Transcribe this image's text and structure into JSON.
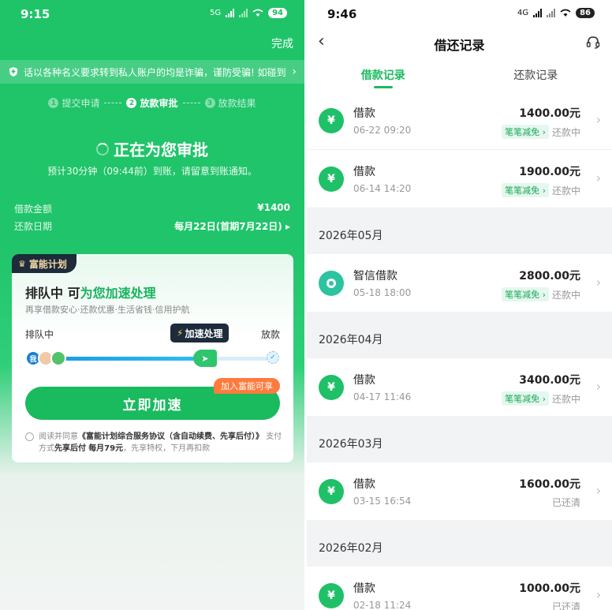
{
  "left": {
    "status": {
      "time": "9:15",
      "network": "5G",
      "battery": "94"
    },
    "done_label": "完成",
    "notice": "话以各种名义要求转到私人账户的均是诈骗，谨防受骗! 如碰到",
    "steps": [
      {
        "num": "1",
        "label": "提交申请"
      },
      {
        "num": "2",
        "label": "放款审批"
      },
      {
        "num": "3",
        "label": "放款结果"
      }
    ],
    "review": {
      "title": "正在为您审批",
      "subtitle": "预计30分钟（09:44前）到账，请留意到账通知。"
    },
    "loan_amount": {
      "label": "借款金额",
      "value": "¥1400"
    },
    "repay_date": {
      "label": "还款日期",
      "value": "每月22日(首期7月22日) ▸"
    },
    "card": {
      "badge": "富能计划",
      "headline_prefix": "排队中 可",
      "headline_accent": "为您加速处理",
      "subline": "再享借款安心·还款优惠·生活省钱·信用护航",
      "queue_label": "排队中",
      "release_label": "放款",
      "speed_tip": "加速处理",
      "avatar_me": "我",
      "queue_progress": 0.68,
      "cta": "立即加速",
      "cta_tag": "加入富能可享",
      "agree_prefix": "阅读并同意",
      "agree_link": "《富能计划综合服务协议（含自动续费、先享后付）》",
      "agree_mid": "支付方式",
      "agree_bold1": "先享后付",
      "agree_fee": "每月79元",
      "agree_tail": "，先享特权，下月再扣款"
    }
  },
  "right": {
    "status": {
      "time": "9:46",
      "network": "4G",
      "battery": "86"
    },
    "title": "借还记录",
    "tabs": [
      {
        "label": "借款记录",
        "active": true
      },
      {
        "label": "还款记录",
        "active": false
      }
    ],
    "top_records": [
      {
        "name": "借款",
        "date": "06-22 09:20",
        "amount": "1400.00元",
        "tag": "笔笔减免 ›",
        "status": "还款中"
      },
      {
        "name": "借款",
        "date": "06-14 14:20",
        "amount": "1900.00元",
        "tag": "笔笔减免 ›",
        "status": "还款中"
      }
    ],
    "months": [
      {
        "label": "2026年05月",
        "records": [
          {
            "name": "智信借款",
            "date": "05-18 18:00",
            "amount": "2800.00元",
            "tag": "笔笔减免 ›",
            "status": "还款中",
            "alt": true
          }
        ]
      },
      {
        "label": "2026年04月",
        "records": [
          {
            "name": "借款",
            "date": "04-17 11:46",
            "amount": "3400.00元",
            "tag": "笔笔减免 ›",
            "status": "还款中"
          }
        ]
      },
      {
        "label": "2026年03月",
        "records": [
          {
            "name": "借款",
            "date": "03-15 16:54",
            "amount": "1600.00元",
            "tag": "",
            "status": "已还清"
          }
        ]
      },
      {
        "label": "2026年02月",
        "records": [
          {
            "name": "借款",
            "date": "02-18 11:24",
            "amount": "1000.00元",
            "tag": "",
            "status": "已还清"
          }
        ]
      }
    ],
    "yuan_symbol": "¥"
  },
  "colors": {
    "brand_green": "#1aba5f",
    "badge_dark": "#1d2b3a",
    "tag_orange": "#ff7a3d"
  }
}
